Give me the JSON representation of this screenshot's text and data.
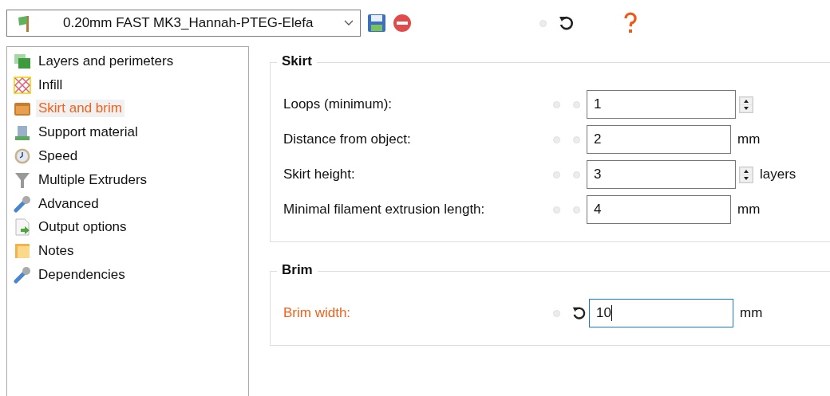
{
  "preset": {
    "value": "0.20mm FAST MK3_Hannah-PTEG-Elefa"
  },
  "tree": [
    {
      "label": "Layers and perimeters",
      "selected": false
    },
    {
      "label": "Infill",
      "selected": false
    },
    {
      "label": "Skirt and brim",
      "selected": true
    },
    {
      "label": "Support material",
      "selected": false
    },
    {
      "label": "Speed",
      "selected": false
    },
    {
      "label": "Multiple Extruders",
      "selected": false
    },
    {
      "label": "Advanced",
      "selected": false
    },
    {
      "label": "Output options",
      "selected": false
    },
    {
      "label": "Notes",
      "selected": false
    },
    {
      "label": "Dependencies",
      "selected": false
    }
  ],
  "groups": [
    {
      "title": "Skirt",
      "options": [
        {
          "label": "Loops (minimum):",
          "kind": "spin",
          "value": "1",
          "modified": false,
          "focused": false
        },
        {
          "label": "Distance from object:",
          "kind": "plain",
          "value": "2",
          "unit": "mm",
          "modified": false,
          "focused": false
        },
        {
          "label": "Skirt height:",
          "kind": "spin",
          "value": "3",
          "unit": "layers",
          "modified": false,
          "focused": false
        },
        {
          "label": "Minimal filament extrusion length:",
          "kind": "plain",
          "value": "4",
          "unit": "mm",
          "modified": false,
          "focused": false
        }
      ]
    },
    {
      "title": "Brim",
      "options": [
        {
          "label": "Brim width:",
          "kind": "plain",
          "value": "10",
          "unit": "mm",
          "modified": true,
          "focused": true
        }
      ]
    }
  ]
}
